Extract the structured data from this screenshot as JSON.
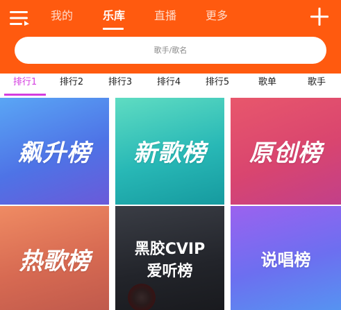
{
  "header": {
    "tabs": [
      {
        "label": "我的",
        "active": false
      },
      {
        "label": "乐库",
        "active": true
      },
      {
        "label": "直播",
        "active": false
      },
      {
        "label": "更多",
        "active": false
      }
    ],
    "menu_icon": "menu-icon",
    "add_icon": "plus-icon",
    "accent_color": "#ff5a0f"
  },
  "search": {
    "placeholder": "歌手/歌名"
  },
  "categories": {
    "items": [
      "排行1",
      "排行2",
      "排行3",
      "排行4",
      "排行5",
      "歌单",
      "歌手"
    ],
    "active_index": 0,
    "active_color": "#d43de0"
  },
  "charts": [
    {
      "title": "飙升榜"
    },
    {
      "title": "新歌榜"
    },
    {
      "title": "原创榜"
    },
    {
      "title": "热歌榜"
    },
    {
      "title_line1": "黑胶CVIP",
      "title_line2": "爱听榜"
    },
    {
      "title": "说唱榜"
    }
  ]
}
